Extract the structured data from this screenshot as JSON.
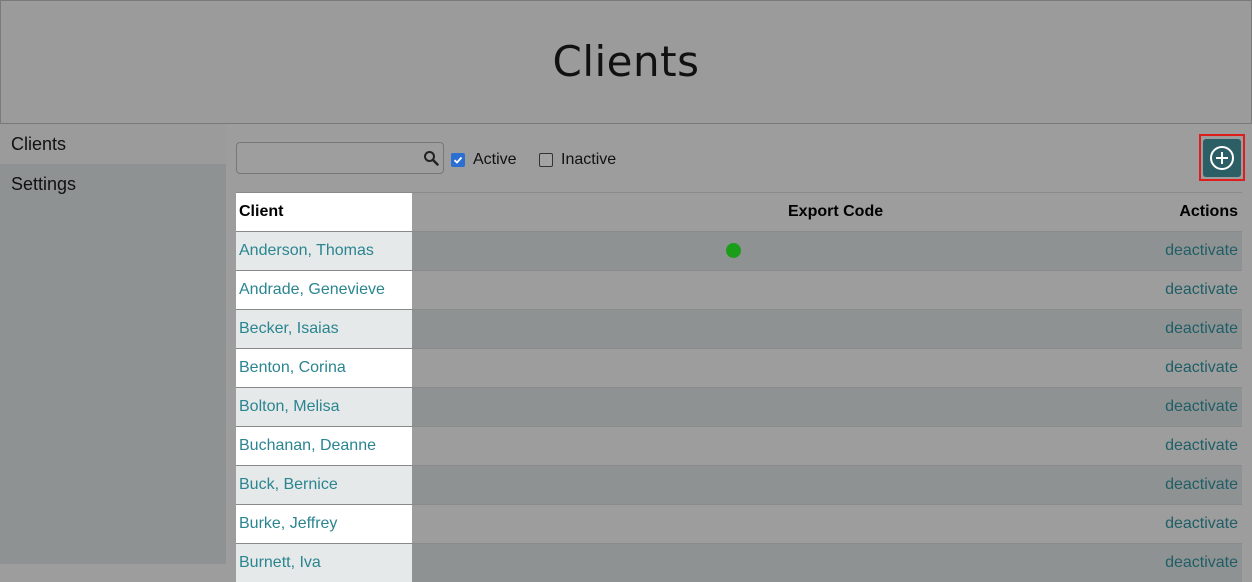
{
  "header": {
    "title": "Clients"
  },
  "sidebar": {
    "items": [
      {
        "label": "Clients"
      },
      {
        "label": "Settings"
      }
    ]
  },
  "filters": {
    "search": {
      "value": "",
      "placeholder": ""
    },
    "active": {
      "label": "Active",
      "checked": true
    },
    "inactive": {
      "label": "Inactive",
      "checked": false
    }
  },
  "colors": {
    "accent": "#2c5e66",
    "link": "#2a8590",
    "checkbox": "#2a6fd1",
    "status_dot": "#1a9e1a",
    "highlight": "#e01d1d"
  },
  "icons": {
    "search": "search-icon",
    "add": "plus-circle-icon",
    "status": "status-dot-icon"
  },
  "table": {
    "headers": {
      "client": "Client",
      "export_code": "Export Code",
      "actions": "Actions"
    },
    "rows": [
      {
        "client": "Anderson, Thomas",
        "action": "deactivate",
        "status_dot": true
      },
      {
        "client": "Andrade, Genevieve",
        "action": "deactivate",
        "status_dot": false
      },
      {
        "client": "Becker, Isaias",
        "action": "deactivate",
        "status_dot": false
      },
      {
        "client": "Benton, Corina",
        "action": "deactivate",
        "status_dot": false
      },
      {
        "client": "Bolton, Melisa",
        "action": "deactivate",
        "status_dot": false
      },
      {
        "client": "Buchanan, Deanne",
        "action": "deactivate",
        "status_dot": false
      },
      {
        "client": "Buck, Bernice",
        "action": "deactivate",
        "status_dot": false
      },
      {
        "client": "Burke, Jeffrey",
        "action": "deactivate",
        "status_dot": false
      },
      {
        "client": "Burnett, Iva",
        "action": "deactivate",
        "status_dot": false
      }
    ]
  }
}
